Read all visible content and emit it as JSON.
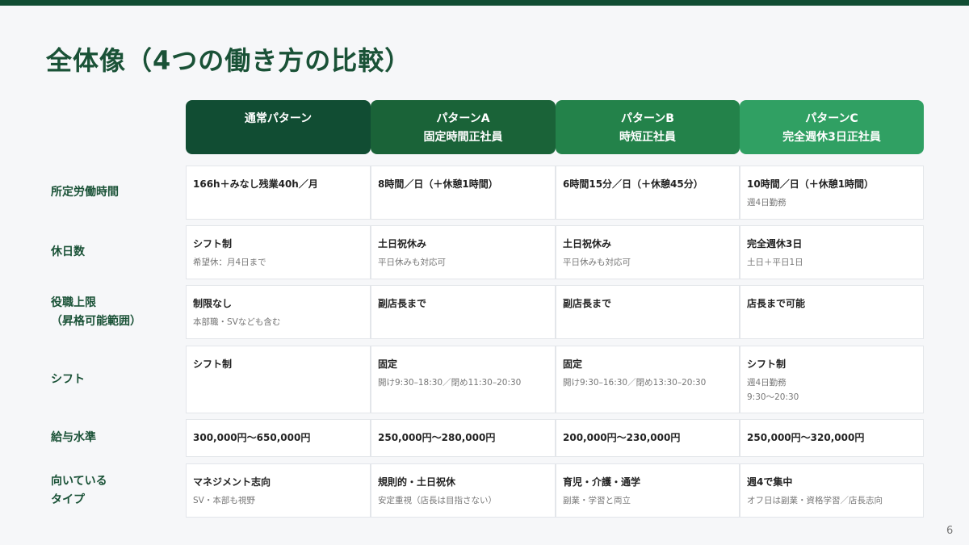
{
  "title": "全体像（4つの働き方の比較）",
  "columns": [
    {
      "line1": "通常パターン",
      "line2": "",
      "color": "#114d33"
    },
    {
      "line1": "パターンA",
      "line2": "固定時間正社員",
      "color": "#1a6338"
    },
    {
      "line1": "パターンB",
      "line2": "時短正社員",
      "color": "#23824a"
    },
    {
      "line1": "パターンC",
      "line2": "完全週休3日正社員",
      "color": "#30a063"
    }
  ],
  "rows": [
    {
      "label": "所定労働時間",
      "cells": [
        {
          "main": "166h＋みなし残業40h／月"
        },
        {
          "main": "8時間／日（＋休憩1時間）"
        },
        {
          "main": "6時間15分／日（＋休憩45分）"
        },
        {
          "main": "10時間／日（＋休憩1時間）",
          "sub": "週4日勤務"
        }
      ]
    },
    {
      "label": "休日数",
      "cells": [
        {
          "main": "シフト制",
          "sub": "希望休：月4日まで"
        },
        {
          "main": "土日祝休み",
          "sub": "平日休みも対応可"
        },
        {
          "main": "土日祝休み",
          "sub": "平日休みも対応可"
        },
        {
          "main": "完全週休3日",
          "sub": "土日＋平日1日"
        }
      ]
    },
    {
      "label": "役職上限",
      "label2": "（昇格可能範囲）",
      "cells": [
        {
          "main": "制限なし",
          "sub": "本部職・SVなども含む"
        },
        {
          "main": "副店長まで"
        },
        {
          "main": "副店長まで"
        },
        {
          "main": "店長まで可能"
        }
      ]
    },
    {
      "label": "シフト",
      "cells": [
        {
          "main": "シフト制"
        },
        {
          "main": "固定",
          "sub": "開け9:30–18:30／閉め11:30–20:30"
        },
        {
          "main": "固定",
          "sub": "開け9:30–16:30／閉め13:30–20:30"
        },
        {
          "main": "シフト制",
          "sub": "週4日勤務",
          "sub2": "9:30〜20:30"
        }
      ]
    },
    {
      "label": "給与水準",
      "cells": [
        {
          "main": "300,000円〜650,000円"
        },
        {
          "main": "250,000円〜280,000円"
        },
        {
          "main": "200,000円〜230,000円"
        },
        {
          "main": "250,000円〜320,000円"
        }
      ]
    },
    {
      "label": "向いている",
      "label2": "タイプ",
      "cells": [
        {
          "main": "マネジメント志向",
          "sub": "SV・本部も視野"
        },
        {
          "main": "規則的・土日祝休",
          "sub": "安定重視（店長は目指さない）"
        },
        {
          "main": "育児・介護・通学",
          "sub": "副業・学習と両立"
        },
        {
          "main": "週4で集中",
          "sub": "オフ日は副業・資格学習／店長志向"
        }
      ]
    }
  ],
  "page_number": "6"
}
